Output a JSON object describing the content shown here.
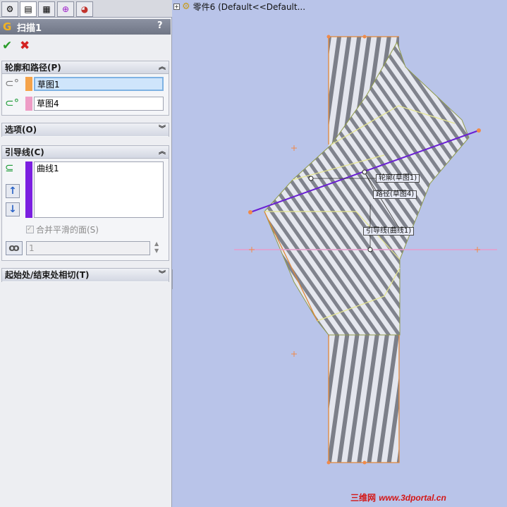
{
  "tabs": [
    {
      "name": "feature-manager-tab",
      "glyph": "⚙"
    },
    {
      "name": "property-manager-tab",
      "glyph": "▤"
    },
    {
      "name": "configuration-manager-tab",
      "glyph": "▦"
    },
    {
      "name": "dimxpert-tab",
      "glyph": "⊕"
    },
    {
      "name": "display-manager-tab",
      "glyph": "◕"
    }
  ],
  "pm": {
    "title": "扫描1",
    "help": "?",
    "ok": "✔",
    "cancel": "✖"
  },
  "profile_path": {
    "header": "轮廓和路径(P)",
    "profile_value": "草图1",
    "path_value": "草图4"
  },
  "options": {
    "header": "选项(O)"
  },
  "guides": {
    "header": "引导线(C)",
    "list_items": [
      "曲线1"
    ],
    "merge_label": "合并平滑的面(S)",
    "spin_value": "1",
    "up_arrow": "↑",
    "down_arrow": "↓"
  },
  "tangency": {
    "header": "起始处/结束处相切(T)"
  },
  "tree": {
    "label": "零件6  (Default<<Default..."
  },
  "callouts": {
    "profile": "轮廓(草图1)",
    "path": "路径(草图4)",
    "guide": "引导线(曲线1)"
  },
  "watermark": {
    "cn": "三维网",
    "url": "www.3dportal.cn"
  },
  "colors": {
    "profile_swatch": "#f5a34a",
    "path_swatch": "#ee9cc6",
    "guide_swatch": "#7b1fe0",
    "guide_line": "#6a1fd3",
    "path_line": "#e79bcb"
  }
}
